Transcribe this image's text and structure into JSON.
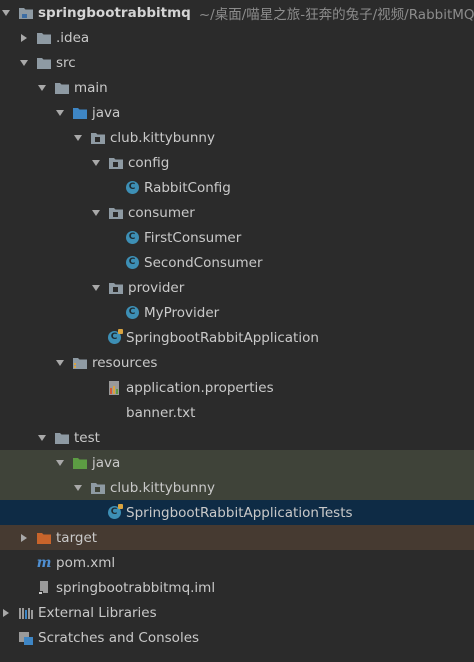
{
  "colors": {
    "background": "#2b2b2b",
    "selected_row": "#0e2b45",
    "test_row": "#3f4339",
    "target_row": "#463a31",
    "folder_gray": "#8e9aa3",
    "folder_blue": "#3e86c5",
    "folder_green": "#5c9c43",
    "folder_orange": "#c8642b",
    "class_badge": "#3d8fb5"
  },
  "project": {
    "name": "springbootrabbitmq",
    "path": "~/桌面/喵星之旅-狂奔的兔子/视频/RabbitMQ"
  },
  "nodes": [
    {
      "label": ".idea",
      "icon": "folder-icon"
    },
    {
      "label": "src",
      "icon": "folder-icon"
    },
    {
      "label": "main",
      "icon": "folder-icon"
    },
    {
      "label": "java",
      "icon": "source-folder-icon"
    },
    {
      "label": "club.kittybunny",
      "icon": "package-icon"
    },
    {
      "label": "config",
      "icon": "package-icon"
    },
    {
      "label": "RabbitConfig",
      "icon": "class-icon"
    },
    {
      "label": "consumer",
      "icon": "package-icon"
    },
    {
      "label": "FirstConsumer",
      "icon": "class-icon"
    },
    {
      "label": "SecondConsumer",
      "icon": "class-icon"
    },
    {
      "label": "provider",
      "icon": "package-icon"
    },
    {
      "label": "MyProvider",
      "icon": "class-icon"
    },
    {
      "label": "SpringbootRabbitApplication",
      "icon": "spring-class-icon"
    },
    {
      "label": "resources",
      "icon": "resources-folder-icon"
    },
    {
      "label": "application.properties",
      "icon": "properties-file-icon"
    },
    {
      "label": "banner.txt",
      "icon": "text-file-icon"
    },
    {
      "label": "test",
      "icon": "folder-icon"
    },
    {
      "label": "java",
      "icon": "test-source-folder-icon"
    },
    {
      "label": "club.kittybunny",
      "icon": "package-icon"
    },
    {
      "label": "SpringbootRabbitApplicationTests",
      "icon": "spring-class-icon"
    },
    {
      "label": "target",
      "icon": "excluded-folder-icon"
    },
    {
      "label": "pom.xml",
      "icon": "maven-icon"
    },
    {
      "label": "springbootrabbitmq.iml",
      "icon": "iml-file-icon"
    },
    {
      "label": "External Libraries",
      "icon": "libraries-icon"
    },
    {
      "label": "Scratches and Consoles",
      "icon": "scratches-icon"
    }
  ]
}
